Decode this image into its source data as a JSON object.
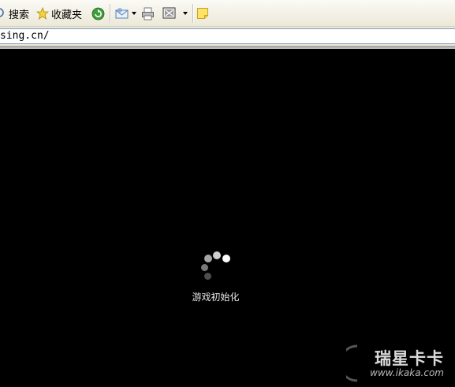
{
  "toolbar": {
    "search_label": "搜索",
    "favorites_label": "收藏夹"
  },
  "address": {
    "value": "sing.cn/"
  },
  "content": {
    "loading_text": "游戏初始化"
  },
  "watermark": {
    "title": "瑞星卡卡",
    "url": "www.ikaka.com"
  },
  "colors": {
    "background": "#000000",
    "toolbar": "#ece9d8",
    "loading_text": "#e6e6e6"
  },
  "icons": [
    "search-icon",
    "star-icon",
    "refresh-icon",
    "mail-icon",
    "print-icon",
    "edit-icon",
    "note-icon"
  ]
}
